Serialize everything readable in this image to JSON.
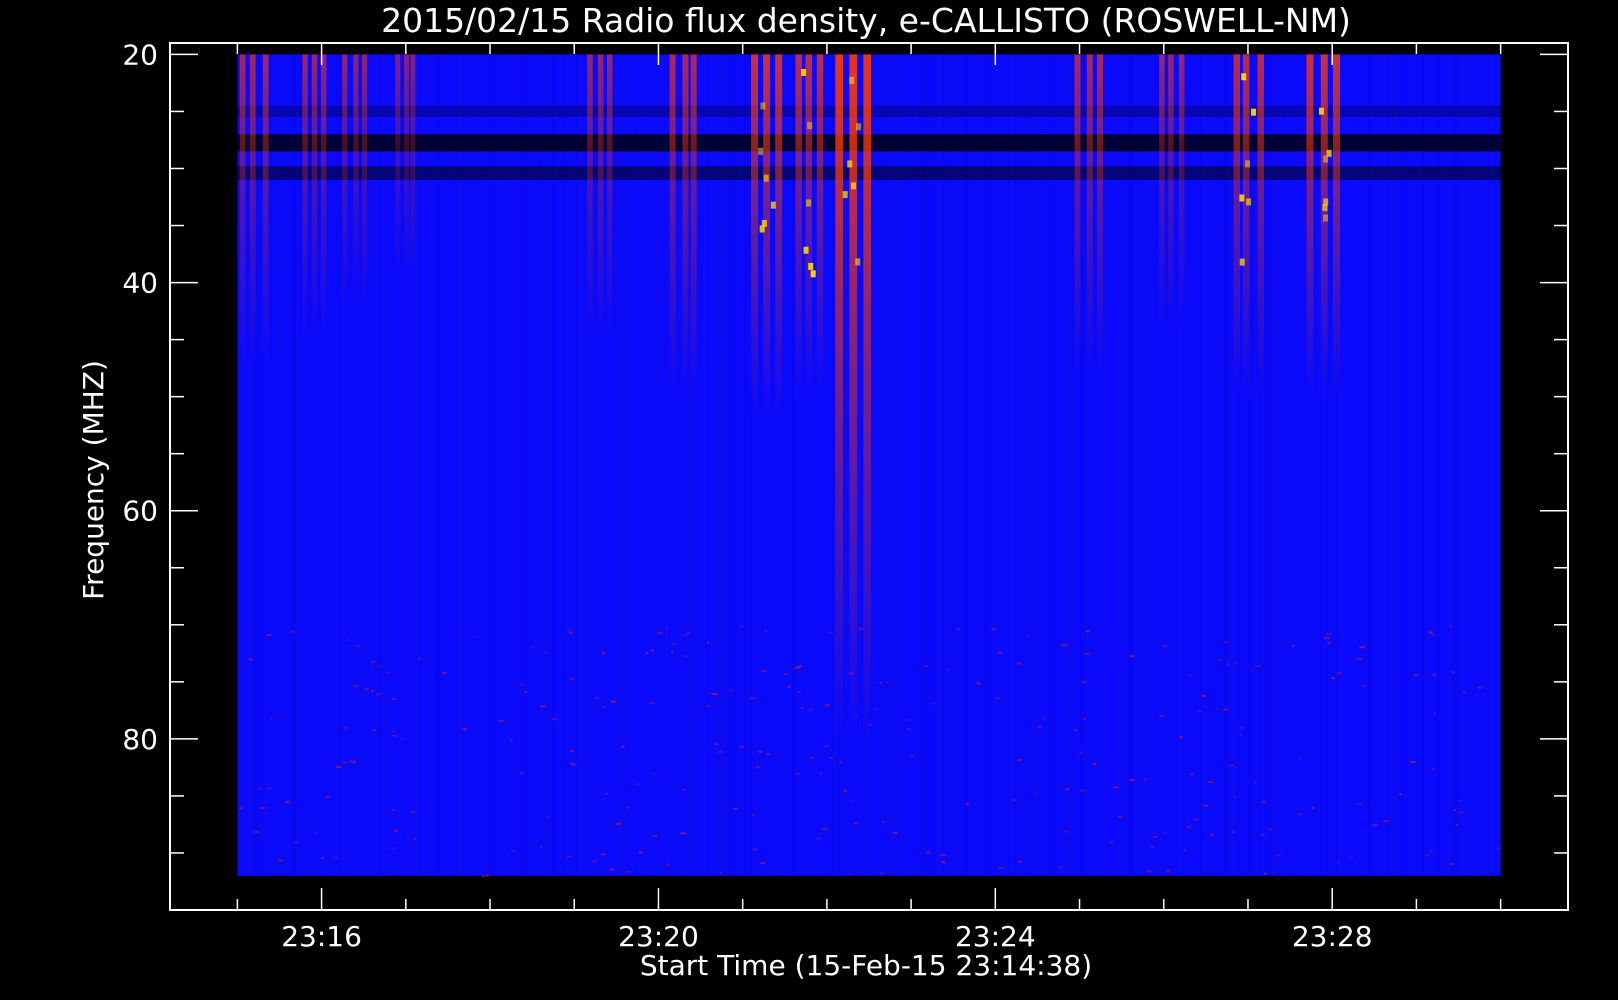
{
  "chart_data": {
    "type": "heatmap",
    "title": "2015/02/15  Radio flux density, e-CALLISTO (ROSWELL-NM)",
    "xlabel": "Start Time (15-Feb-15 23:14:38)",
    "ylabel": "Frequency (MHZ)",
    "x_tick_labels": [
      "23:16",
      "23:20",
      "23:24",
      "23:28"
    ],
    "x_tick_values_min": [
      16,
      20,
      24,
      28
    ],
    "y_tick_labels": [
      "20",
      "40",
      "60",
      "80"
    ],
    "y_tick_values": [
      20,
      40,
      60,
      80
    ],
    "xlim_min": [
      14.2,
      30.8
    ],
    "ylim": [
      19,
      95
    ],
    "y_inverted": true,
    "data_time_range_min": [
      15.0,
      30.0
    ],
    "data_freq_range_mhz": [
      20,
      92
    ],
    "background_color": "#0a0aff",
    "hot_colors": [
      "#ff3a00",
      "#ffd000"
    ],
    "bursts": [
      {
        "t_min": 15.2,
        "f_max": 47,
        "intensity": 0.55
      },
      {
        "t_min": 15.9,
        "f_max": 45,
        "intensity": 0.5
      },
      {
        "t_min": 16.4,
        "f_max": 42,
        "intensity": 0.45
      },
      {
        "t_min": 17.0,
        "f_max": 40,
        "intensity": 0.4
      },
      {
        "t_min": 19.3,
        "f_max": 45,
        "intensity": 0.5
      },
      {
        "t_min": 20.3,
        "f_max": 50,
        "intensity": 0.6
      },
      {
        "t_min": 21.3,
        "f_max": 52,
        "intensity": 0.8
      },
      {
        "t_min": 21.8,
        "f_max": 50,
        "intensity": 0.7
      },
      {
        "t_min": 22.3,
        "f_max": 80,
        "intensity": 0.95
      },
      {
        "t_min": 25.1,
        "f_max": 48,
        "intensity": 0.6
      },
      {
        "t_min": 26.1,
        "f_max": 44,
        "intensity": 0.5
      },
      {
        "t_min": 27.0,
        "f_max": 50,
        "intensity": 0.7
      },
      {
        "t_min": 27.9,
        "f_max": 50,
        "intensity": 0.8
      }
    ]
  }
}
